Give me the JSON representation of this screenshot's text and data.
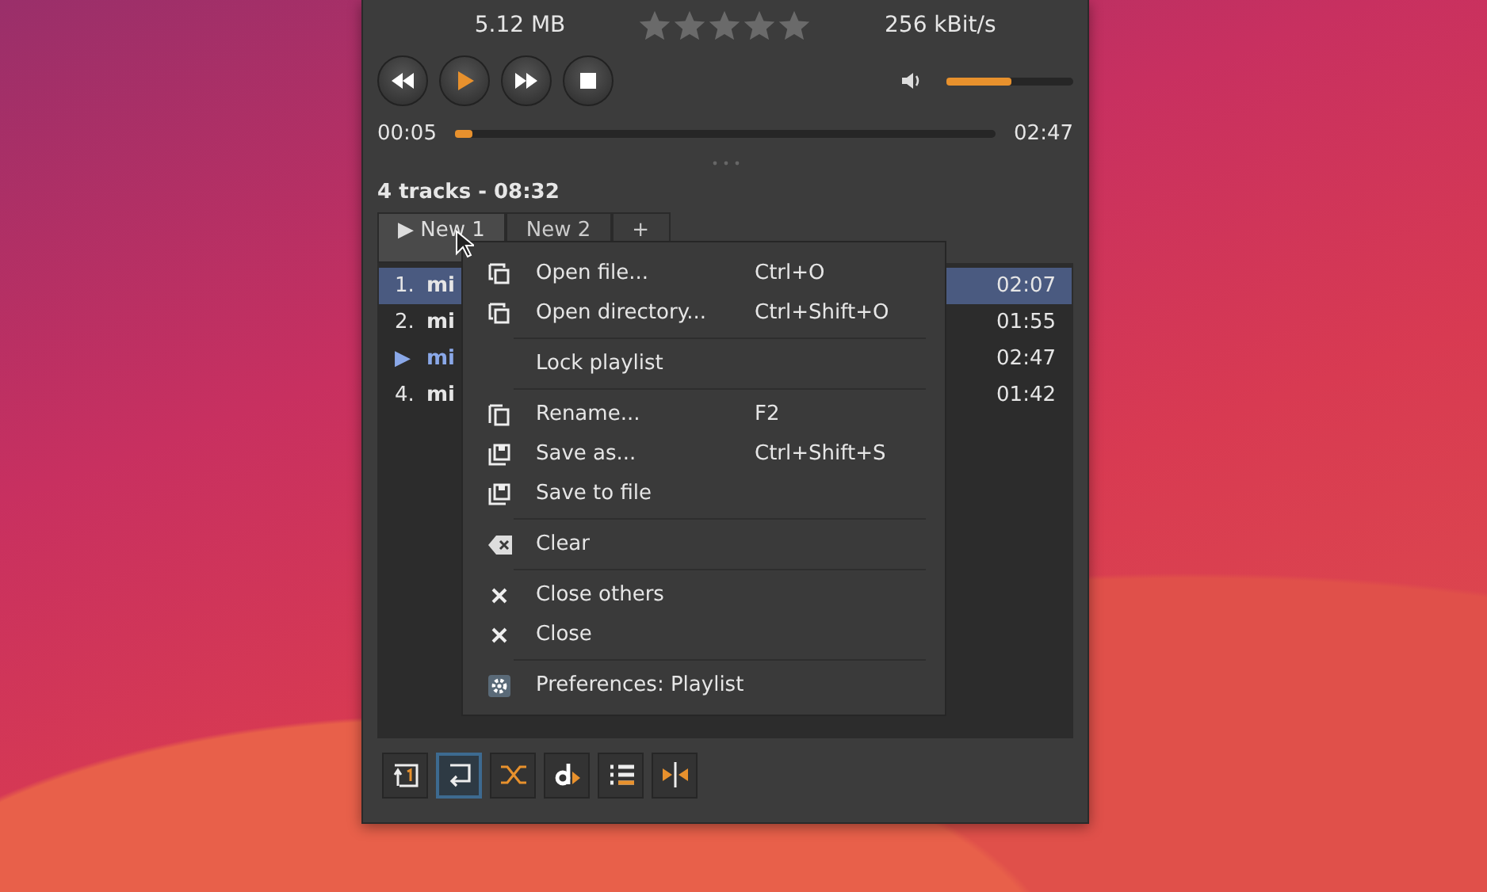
{
  "info": {
    "file_size": "5.12 MB",
    "stars": 0,
    "bitrate": "256 kBit/s"
  },
  "transport": {
    "buttons": [
      {
        "kind": "previous",
        "selected": false
      },
      {
        "kind": "play",
        "selected": true
      },
      {
        "kind": "next",
        "selected": false
      },
      {
        "kind": "stop",
        "selected": false
      }
    ],
    "volume": {
      "level": 0.51
    }
  },
  "seek": {
    "elapsed": "00:05",
    "level": 0.03,
    "total": "02:47"
  },
  "summary": "4 tracks - 08:32",
  "tabs": [
    {
      "label": "▶ New 1",
      "selected": true
    },
    {
      "label": "New 2",
      "selected": false
    },
    {
      "label": "+",
      "selected": false
    }
  ],
  "tracks": [
    {
      "number": "1.",
      "title": "mi",
      "duration": "02:07",
      "selected": true,
      "playing": false
    },
    {
      "number": "2.",
      "title": "mi",
      "duration": "01:55",
      "selected": false,
      "playing": false
    },
    {
      "number": "▶",
      "title": "mi",
      "duration": "02:47",
      "selected": false,
      "playing": true
    },
    {
      "number": "4.",
      "title": "mi",
      "duration": "01:42",
      "selected": false,
      "playing": false
    }
  ],
  "context_menu": {
    "groups": [
      [
        {
          "kind": "copy",
          "label": "Open file...",
          "shortcut": "Ctrl+O"
        },
        {
          "kind": "copy",
          "label": "Open directory...",
          "shortcut": "Ctrl+Shift+O"
        }
      ],
      [
        {
          "kind": "plain",
          "label": "Lock playlist"
        }
      ],
      [
        {
          "kind": "page",
          "label": "Rename...",
          "shortcut": "F2"
        },
        {
          "kind": "save",
          "label": "Save as...",
          "shortcut": "Ctrl+Shift+S"
        },
        {
          "kind": "save",
          "label": "Save to file"
        }
      ],
      [
        {
          "kind": "erase",
          "label": "Clear"
        }
      ],
      [
        {
          "kind": "close",
          "label": "Close others"
        },
        {
          "kind": "close",
          "label": "Close"
        }
      ],
      [
        {
          "kind": "gear",
          "label": "Preferences: Playlist"
        }
      ]
    ]
  },
  "toolbar": [
    {
      "kind": "queue",
      "selected": false
    },
    {
      "kind": "repeat",
      "selected": true
    },
    {
      "kind": "shuffle",
      "selected": false
    },
    {
      "kind": "dynamic",
      "selected": false
    },
    {
      "kind": "list",
      "selected": false
    },
    {
      "kind": "split",
      "selected": false
    }
  ]
}
